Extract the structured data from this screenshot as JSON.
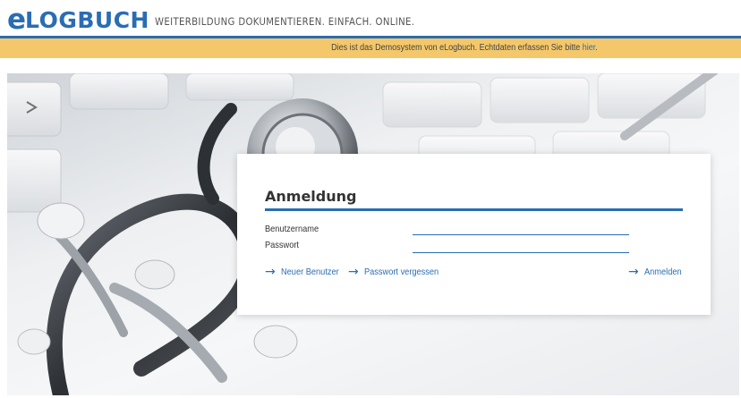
{
  "header": {
    "logo_e": "e",
    "logo_text": "LOGBUCH",
    "tagline": "WEITERBILDUNG DOKUMENTIEREN. EINFACH. ONLINE."
  },
  "demo_banner": {
    "text": "Dies ist das Demosystem von eLogbuch. Echtdaten erfassen Sie bitte ",
    "link": "hier",
    "suffix": "."
  },
  "login": {
    "title": "Anmeldung",
    "username_label": "Benutzername",
    "password_label": "Passwort",
    "username_value": "",
    "password_value": "",
    "new_user": "Neuer Benutzer",
    "forgot_password": "Passwort vergessen",
    "submit": "Anmelden"
  },
  "icons": {
    "arrow": "arrow-right-icon"
  },
  "colors": {
    "accent": "#2a6db2",
    "banner": "#f4c86a"
  }
}
